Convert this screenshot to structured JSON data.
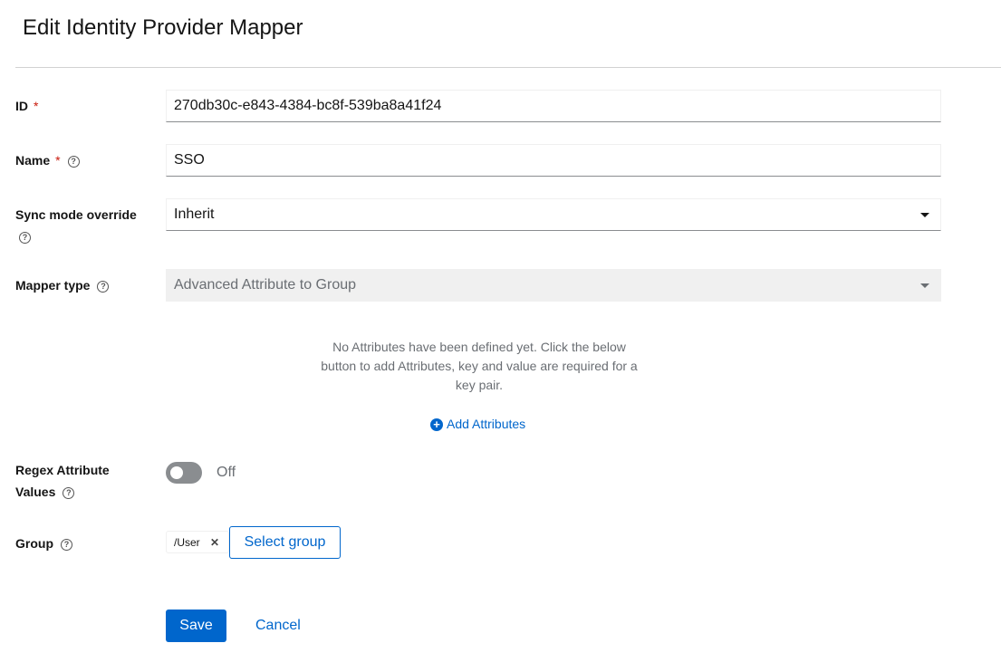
{
  "page_title": "Edit Identity Provider Mapper",
  "fields": {
    "id": {
      "label": "ID",
      "required": "*",
      "value": "270db30c-e843-4384-bc8f-539ba8a41f24"
    },
    "name": {
      "label": "Name",
      "required": "*",
      "value": "SSO"
    },
    "sync_mode": {
      "label": "Sync mode override",
      "value": "Inherit"
    },
    "mapper_type": {
      "label": "Mapper type",
      "value": "Advanced Attribute to Group"
    },
    "attributes": {
      "empty_text": "No Attributes have been defined yet. Click the below button to add Attributes, key and value are required for a key pair.",
      "add_label": "Add Attributes"
    },
    "regex": {
      "label": "Regex Attribute Values",
      "state": "Off",
      "enabled": false
    },
    "group": {
      "label": "Group",
      "chip": "/User",
      "select_label": "Select group"
    }
  },
  "actions": {
    "save": "Save",
    "cancel": "Cancel"
  },
  "colors": {
    "primary": "#0066cc",
    "required": "#c9190b"
  }
}
